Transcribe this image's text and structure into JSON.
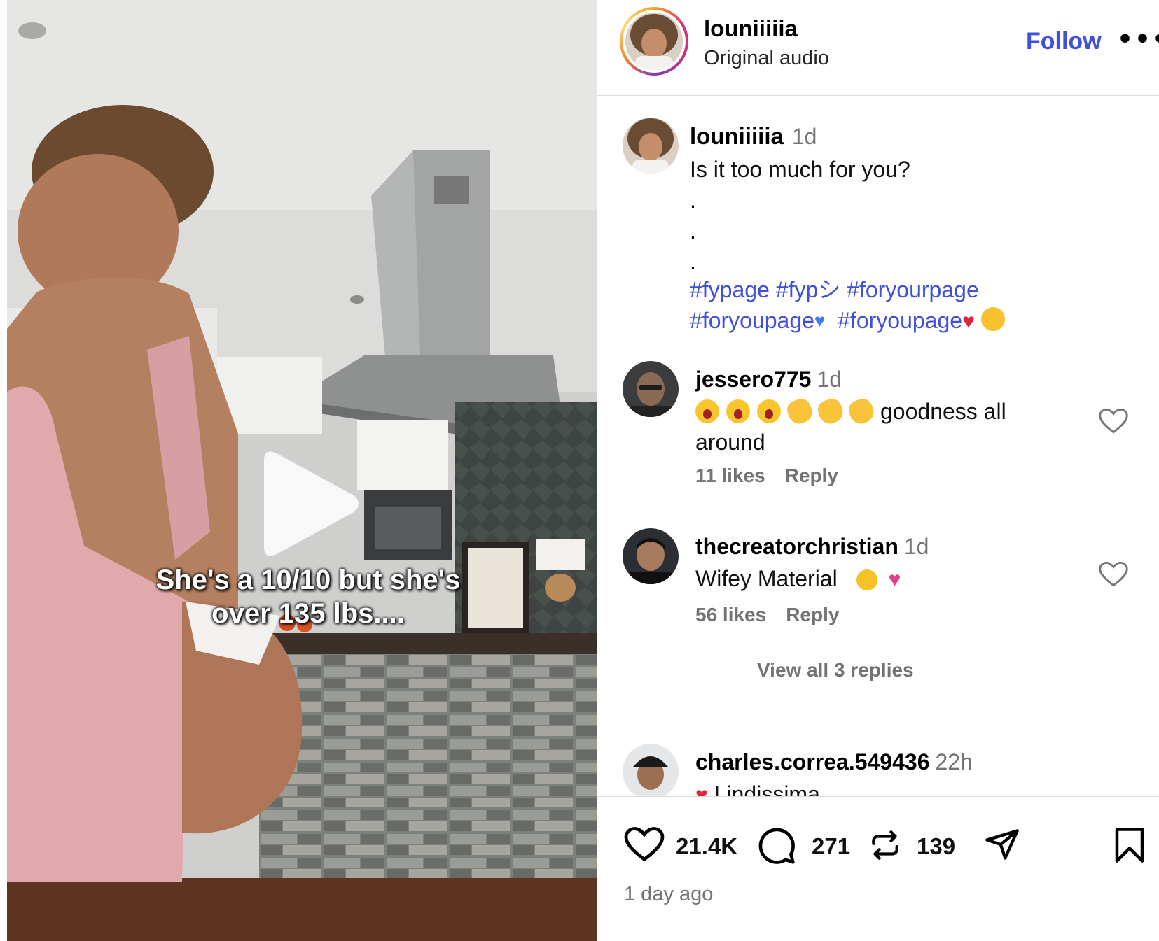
{
  "video": {
    "overlay_line1": "She's a 10/10 but she's",
    "overlay_line2": "over 135 lbs...."
  },
  "header": {
    "username": "louniiiiia",
    "audio": "Original audio",
    "follow_label": "Follow",
    "more_label": "•••"
  },
  "caption": {
    "username": "louniiiiia",
    "time": "1d",
    "text": "Is it too much for you?",
    "dots": [
      ".",
      ".",
      "."
    ],
    "hashtags": [
      "#fypage",
      "#fypシ",
      "#foryourpage",
      "#foryoupage",
      "#foryoupage"
    ]
  },
  "comments": [
    {
      "username": "jessero775",
      "time": "1d",
      "text": "goodness all around",
      "likes": "11 likes",
      "reply": "Reply"
    },
    {
      "username": "thecreatorchristian",
      "time": "1d",
      "text": "Wifey Material",
      "likes": "56 likes",
      "reply": "Reply",
      "view_replies": "View all 3 replies"
    },
    {
      "username": "charles.correa.549436",
      "time": "22h",
      "text": "Lindissima"
    }
  ],
  "footer": {
    "likes_count": "21.4K",
    "comments_count": "271",
    "reposts_count": "139",
    "timestamp": "1 day ago"
  },
  "colors": {
    "link_blue": "#4150d9",
    "muted_gray": "#737373",
    "divider": "#dbdbdb"
  },
  "icons": [
    "play-icon",
    "more-icon",
    "heart-icon",
    "comment-icon",
    "repost-icon",
    "share-icon",
    "bookmark-icon"
  ]
}
